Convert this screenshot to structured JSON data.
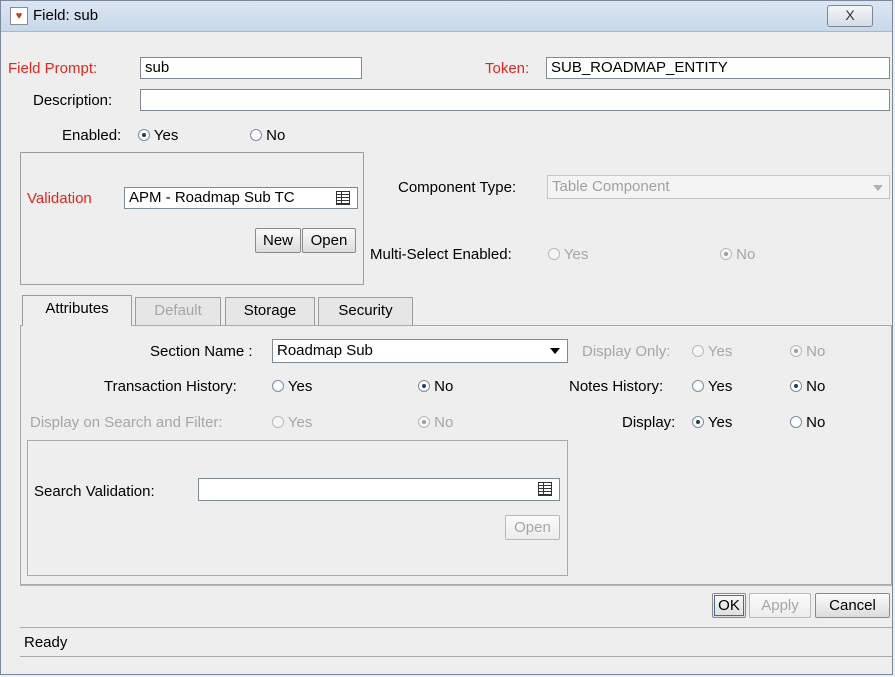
{
  "window": {
    "title": "Field: sub",
    "close_label": "X"
  },
  "header": {
    "field_prompt_label": "Field Prompt:",
    "field_prompt_value": "sub",
    "token_label": "Token:",
    "token_value": "SUB_ROADMAP_ENTITY",
    "description_label": "Description:",
    "description_value": "",
    "enabled_label": "Enabled:",
    "enabled_yes": "Yes",
    "enabled_no": "No",
    "enabled_selected": "Yes"
  },
  "validation": {
    "label": "Validation",
    "value": "APM - Roadmap Sub TC",
    "new_label": "New",
    "open_label": "Open"
  },
  "component": {
    "type_label": "Component Type:",
    "type_value": "Table Component",
    "multi_select_label": "Multi-Select Enabled:",
    "multi_select_yes": "Yes",
    "multi_select_no": "No",
    "multi_select_selected": "No"
  },
  "tabs": [
    {
      "label": "Attributes",
      "active": true,
      "enabled": true
    },
    {
      "label": "Default",
      "active": false,
      "enabled": false
    },
    {
      "label": "Storage",
      "active": false,
      "enabled": true
    },
    {
      "label": "Security",
      "active": false,
      "enabled": true
    }
  ],
  "attributes": {
    "section_name_label": "Section Name :",
    "section_name_value": "Roadmap Sub",
    "display_only_label": "Display Only:",
    "transaction_history_label": "Transaction History:",
    "notes_history_label": "Notes History:",
    "display_search_filter_label": "Display on Search and Filter:",
    "display_label": "Display:",
    "yes": "Yes",
    "no": "No",
    "search_validation_label": "Search Validation:",
    "search_validation_value": "",
    "search_open_label": "Open"
  },
  "footer": {
    "ok_label": "OK",
    "apply_label": "Apply",
    "cancel_label": "Cancel",
    "status": "Ready"
  },
  "colors": {
    "required_label": "#e0281f",
    "disabled_text": "#a6a6a6",
    "titlebar": "#c8d8ea"
  }
}
